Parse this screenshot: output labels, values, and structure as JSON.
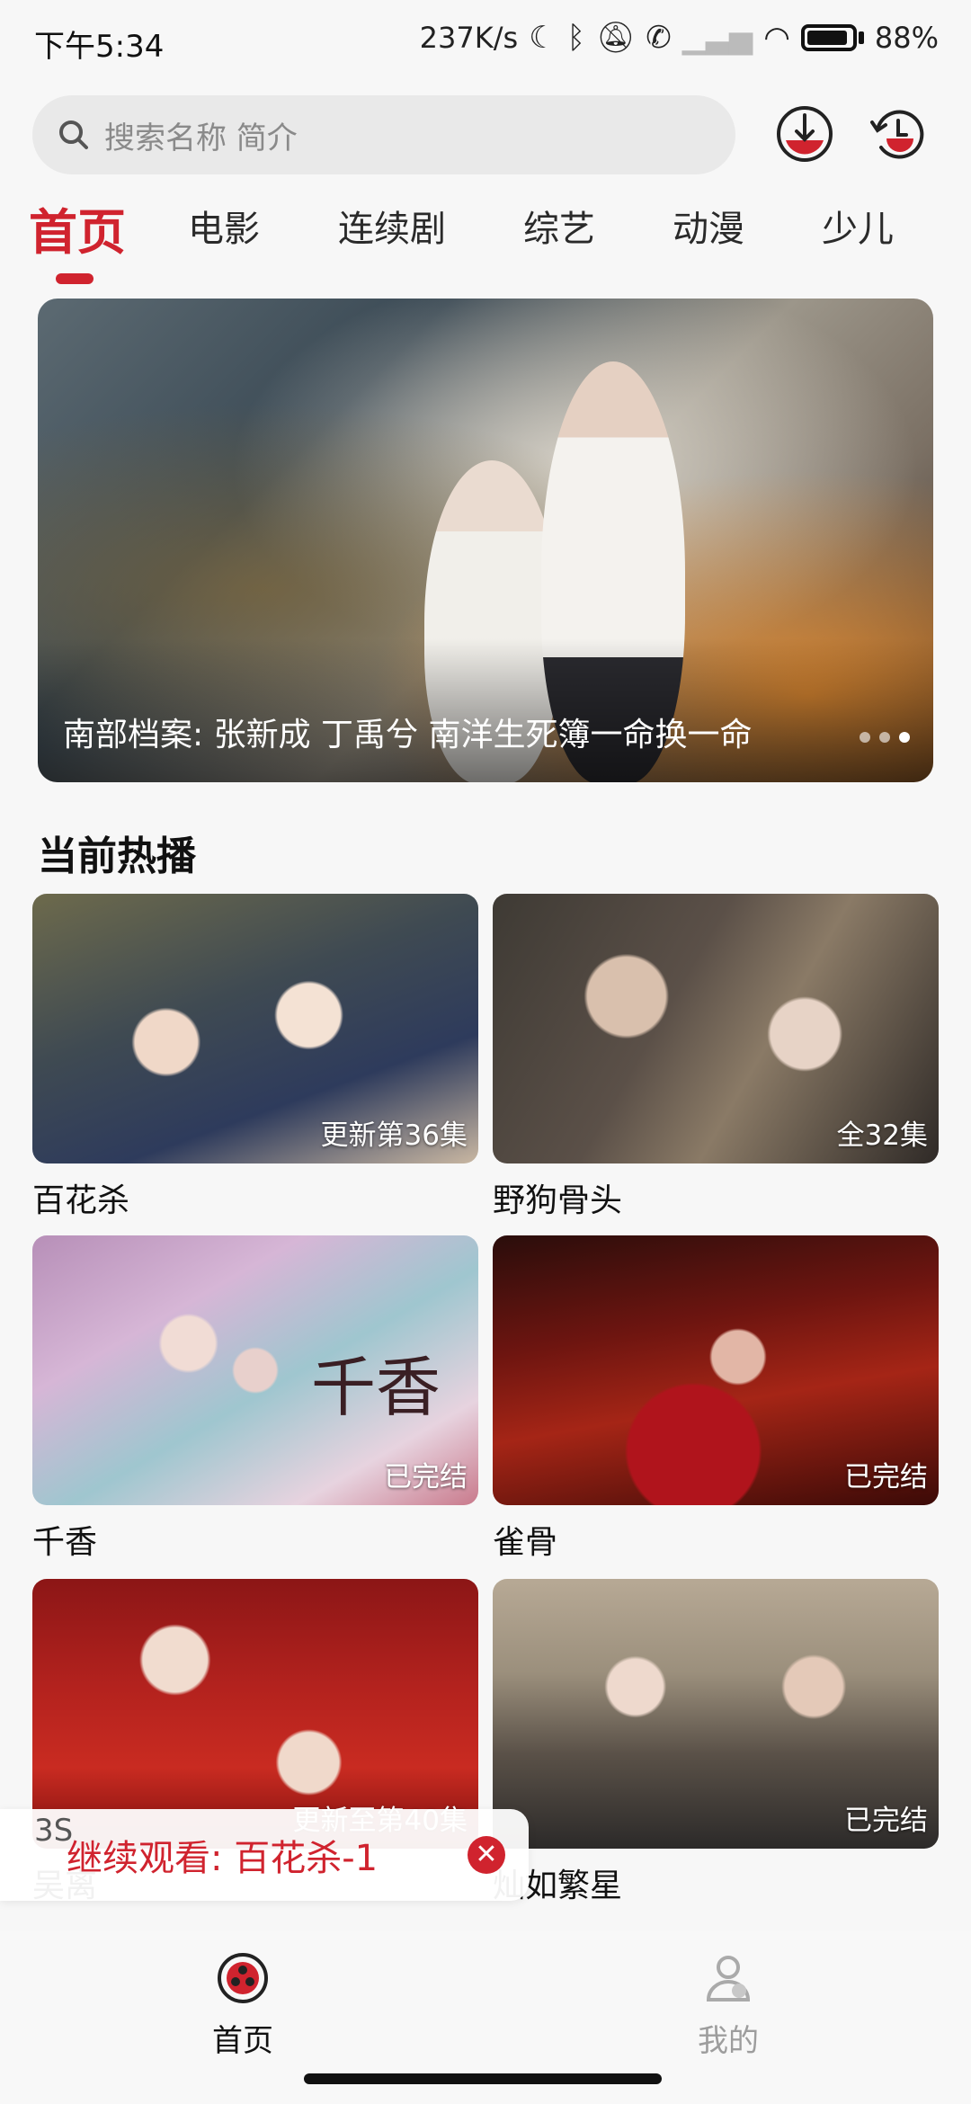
{
  "status_bar": {
    "time": "下午5:34",
    "net_speed": "237K/s",
    "battery": "88%",
    "icons": [
      "moon-icon",
      "bluetooth-icon",
      "mute-icon",
      "call-icon",
      "signal-icon",
      "wifi-icon",
      "battery-icon"
    ]
  },
  "search": {
    "placeholder": "搜索名称 简介"
  },
  "header_icons": [
    "download-icon",
    "history-icon"
  ],
  "tabs": [
    {
      "label": "首页",
      "active": true
    },
    {
      "label": "电影"
    },
    {
      "label": "连续剧"
    },
    {
      "label": "综艺"
    },
    {
      "label": "动漫"
    },
    {
      "label": "少儿"
    }
  ],
  "banner": {
    "caption": "南部档案: 张新成 丁禹兮 南洋生死簿一命换一命",
    "dots": 3,
    "active_dot": 3
  },
  "section": {
    "title": "当前热播"
  },
  "cards": [
    {
      "title": "百花杀",
      "badge": "更新第36集"
    },
    {
      "title": "野狗骨头",
      "badge": "全32集"
    },
    {
      "title": "千香",
      "badge": "已完结",
      "poster_text": "千香"
    },
    {
      "title": "雀骨",
      "badge": "已完结"
    },
    {
      "title": "吴离",
      "badge": "更新至第40集"
    },
    {
      "title": "灿如繁星",
      "badge": "已完结"
    }
  ],
  "continue_watching": {
    "label": "继续观看: 百花杀-1",
    "countdown": "3S"
  },
  "bottom_nav": [
    {
      "label": "首页",
      "active": true
    },
    {
      "label": "我的",
      "active": false
    }
  ],
  "colors": {
    "accent": "#d0232e",
    "inactive": "#9d9d9d"
  }
}
